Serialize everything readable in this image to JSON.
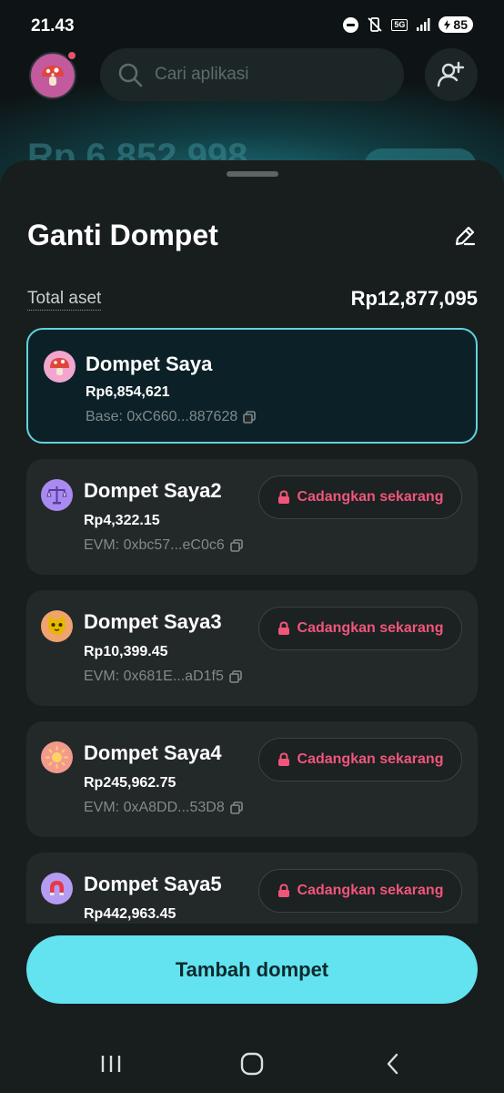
{
  "status_bar": {
    "time": "21.43",
    "network": "5G",
    "battery": "85"
  },
  "top_bar": {
    "search_placeholder": "Cari aplikasi"
  },
  "background": {
    "balance_partial": "Rp 6,852,998"
  },
  "sheet": {
    "title": "Ganti Dompet",
    "total_label": "Total aset",
    "total_value": "Rp12,877,095",
    "backup_label": "Cadangkan sekarang",
    "add_button_label": "Tambah dompet"
  },
  "wallets": [
    {
      "name": "Dompet Saya",
      "balance": "Rp6,854,621",
      "address": "Base: 0xC660...887628",
      "avatar_icon": "mushroom-icon",
      "avatar_color": "#f2a6cf",
      "active": true
    },
    {
      "name": "Dompet Saya2",
      "balance": "Rp4,322.15",
      "address": "EVM: 0xbc57...eC0c6",
      "avatar_icon": "scales-icon",
      "avatar_color": "#a98af0",
      "active": false
    },
    {
      "name": "Dompet Saya3",
      "balance": "Rp10,399.45",
      "address": "EVM: 0x681E...aD1f5",
      "avatar_icon": "cat-icon",
      "avatar_color": "#f0a36e",
      "active": false
    },
    {
      "name": "Dompet Saya4",
      "balance": "Rp245,962.75",
      "address": "EVM: 0xA8DD...53D8",
      "avatar_icon": "sun-icon",
      "avatar_color": "#f29a8e",
      "active": false
    },
    {
      "name": "Dompet Saya5",
      "balance": "Rp442,963.45",
      "address": "",
      "avatar_icon": "magnet-icon",
      "avatar_color": "#b59cf2",
      "active": false
    }
  ],
  "colors": {
    "accent": "#63e2ef",
    "backup_text": "#f0567a",
    "sheet_bg": "#181d1e",
    "card_bg": "#232829"
  }
}
